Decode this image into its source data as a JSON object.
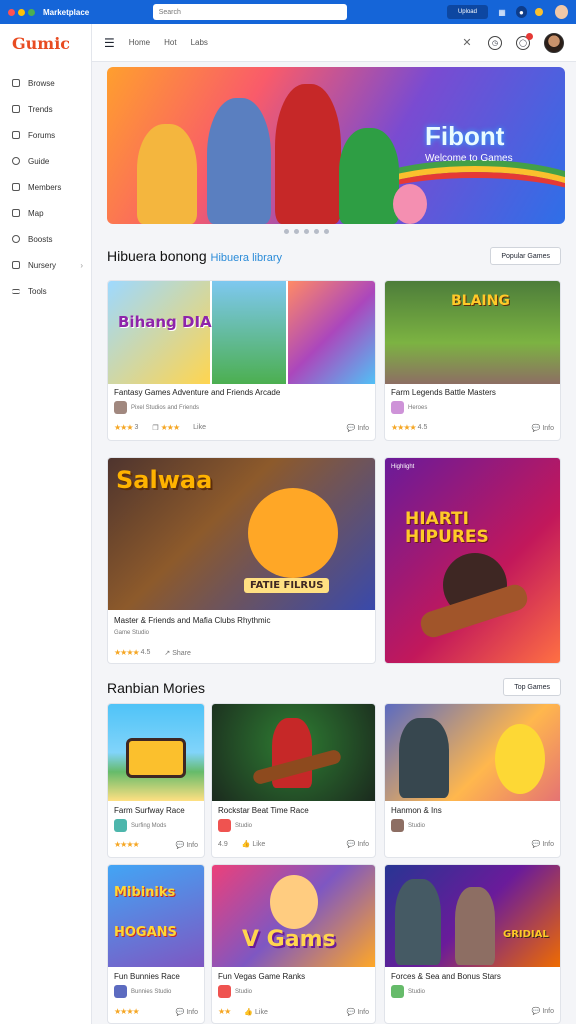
{
  "topbar": {
    "title": "Marketplace",
    "url_placeholder": "Search",
    "action_label": "Upload",
    "colors": {
      "bar": "#1565d8",
      "dot1": "#ff5252",
      "dot2": "#ffc107",
      "dot3": "#4caf50"
    }
  },
  "sidebar": {
    "logo": "Gumic",
    "items": [
      {
        "label": "Browse",
        "icon": "browse-icon"
      },
      {
        "label": "Trends",
        "icon": "trends-icon"
      },
      {
        "label": "Forums",
        "icon": "forums-icon"
      },
      {
        "label": "Guide",
        "icon": "guide-icon"
      },
      {
        "label": "Members",
        "icon": "members-icon"
      },
      {
        "label": "Map",
        "icon": "map-icon"
      },
      {
        "label": "Boosts",
        "icon": "boosts-icon"
      },
      {
        "label": "Nursery",
        "icon": "nursery-icon"
      },
      {
        "label": "Tools",
        "icon": "tools-icon"
      }
    ]
  },
  "header": {
    "tabs": [
      "Home",
      "Hot",
      "Labs"
    ]
  },
  "hero": {
    "title": "Fibont",
    "subtitle": "Welcome to Games"
  },
  "section1": {
    "title": "Hibuera bonong",
    "link": "Hibuera library",
    "button": "Popular Games"
  },
  "section2": {
    "title": "Ranbian Mories",
    "button": "Top Games"
  },
  "cards": [
    {
      "name": "featured-card-1",
      "title": "Fantasy Games Adventure and Friends Arcade",
      "author": "Pixel Studios and Friends",
      "rating": "3",
      "mid": "4.8",
      "views": "Like",
      "comments": "Info",
      "thumb_text": "Bihang DIAMS"
    },
    {
      "name": "featured-card-2",
      "title": "Farm Legends Battle Masters",
      "author": "Heroes",
      "rating": "4.5",
      "mid": "",
      "views": "",
      "comments": "Info",
      "thumb_text": "BLAING"
    },
    {
      "name": "big-card-1",
      "title": "Master & Friends and Mafia Clubs Rhythmic",
      "author": "Game Studio",
      "rating": "4.5",
      "mid": "Share",
      "views": "",
      "comments": "",
      "thumb_text": "Salwaa",
      "badge_text": "FATIE FILRUS"
    },
    {
      "name": "big-card-2",
      "title": "",
      "author": "",
      "rating": "",
      "mid": "",
      "views": "",
      "comments": "",
      "thumb_text": "HIARTI HIPURES",
      "tag": "Highlight"
    },
    {
      "name": "grid-card-1",
      "title": "Farm Surfway Race",
      "author": "Surfing Mods",
      "rating": "4.5",
      "mid": "",
      "views": "",
      "comments": "Info"
    },
    {
      "name": "grid-card-2",
      "title": "Rockstar Beat Time Race",
      "author": "Studio",
      "rating": "4.9",
      "mid": "Like",
      "views": "",
      "comments": "Info"
    },
    {
      "name": "grid-card-3",
      "title": "Hanmon & Ins",
      "author": "Studio",
      "rating": "",
      "mid": "",
      "views": "",
      "comments": "Info"
    },
    {
      "name": "grid-card-4",
      "title": "Fun Bunnies Race",
      "author": "Bunnies Studio",
      "rating": "4.5",
      "mid": "",
      "views": "",
      "comments": "Info",
      "thumb_text": "Mibiniks HOGANS"
    },
    {
      "name": "grid-card-5",
      "title": "Fun Vegas Game Ranks",
      "author": "Studio",
      "rating": "4.9",
      "mid": "Like",
      "views": "",
      "comments": "Info",
      "thumb_text": "V Gams"
    },
    {
      "name": "grid-card-6",
      "title": "Forces & Sea and Bonus Stars",
      "author": "Studio",
      "rating": "",
      "mid": "",
      "views": "",
      "comments": "Info",
      "thumb_text": "GRIDIAL"
    }
  ]
}
